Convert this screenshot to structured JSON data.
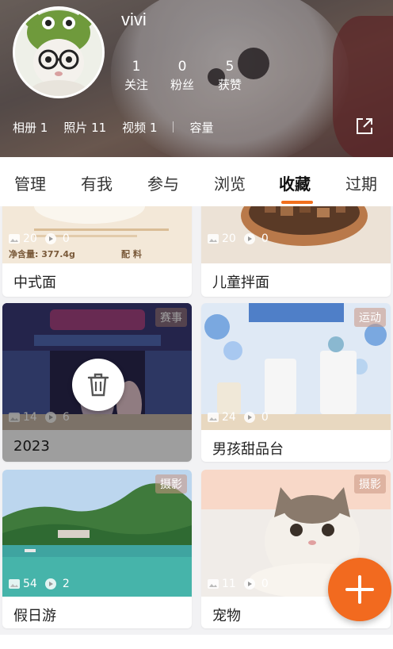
{
  "profile": {
    "username": "vivi",
    "stats": [
      {
        "value": "1",
        "label": "关注"
      },
      {
        "value": "0",
        "label": "粉丝"
      },
      {
        "value": "5",
        "label": "获赞"
      }
    ],
    "info": {
      "albums": "相册 1",
      "photos": "照片 11",
      "videos": "视频 1",
      "capacity": "容量"
    }
  },
  "tabs": [
    "管理",
    "有我",
    "参与",
    "浏览",
    "收藏",
    "过期"
  ],
  "active_tab": "收藏",
  "albums": [
    {
      "title": "中式面",
      "photos": "20",
      "views": "0",
      "packaging_text": "净含量: 377.4g",
      "packaging_text2": "配 料"
    },
    {
      "title": "儿童拌面",
      "photos": "20",
      "views": "0"
    },
    {
      "title": "2023",
      "photos": "14",
      "views": "6",
      "badge": "赛事"
    },
    {
      "title": "男孩甜品台",
      "photos": "24",
      "views": "0",
      "badge": "运动"
    },
    {
      "title": "假日游",
      "photos": "54",
      "views": "2",
      "badge": "摄影"
    },
    {
      "title": "宠物",
      "photos": "11",
      "views": "0",
      "badge": "摄影"
    }
  ],
  "colors": {
    "accent": "#f26a1f",
    "tab_active": "#111111",
    "card_bg": "#ffffff"
  },
  "icons": {
    "share": "share-icon",
    "delete": "trash-icon",
    "add": "plus-icon",
    "photo_count": "image-icon",
    "view_count": "play-icon"
  }
}
